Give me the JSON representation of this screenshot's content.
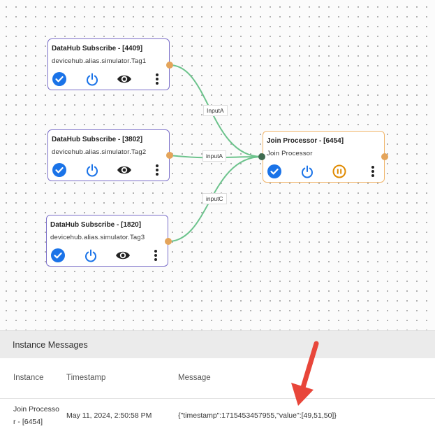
{
  "nodes": [
    {
      "title": "DataHub Subscribe - [4409]",
      "subtitle": "devicehub.alias.simulator.Tag1",
      "kind": "subscribe"
    },
    {
      "title": "DataHub Subscribe - [3802]",
      "subtitle": "devicehub.alias.simulator.Tag2",
      "kind": "subscribe"
    },
    {
      "title": "DataHub Subscribe - [1820]",
      "subtitle": "devicehub.alias.simulator.Tag3",
      "kind": "subscribe"
    },
    {
      "title": "Join Processor - [6454]",
      "subtitle": "Join Processor",
      "kind": "join"
    }
  ],
  "edges": [
    {
      "label": "InputA"
    },
    {
      "label": "inputA"
    },
    {
      "label": "inputC"
    }
  ],
  "colors": {
    "check_blue": "#1a73e8",
    "power_blue": "#1a73e8",
    "pause_orange": "#e08a00",
    "wire_green": "#6cc38c",
    "port_orange": "#e4a45a",
    "subscribe_border": "#7b6fc9",
    "join_border": "#f0b56a",
    "annotation_red": "#e8463a"
  },
  "icons": [
    "check-circle-icon",
    "power-icon",
    "eye-icon",
    "more-vert-icon",
    "pause-circle-icon"
  ],
  "messages_panel": {
    "title": "Instance Messages",
    "columns": [
      "Instance",
      "Timestamp",
      "Message"
    ],
    "rows": [
      {
        "instance_line1": "Join Processo",
        "instance_line2": "r - [6454]",
        "timestamp": "May 11, 2024, 2:50:58 PM",
        "message": "{\"timestamp\":1715453457955,\"value\":[49,51,50]}"
      }
    ]
  }
}
